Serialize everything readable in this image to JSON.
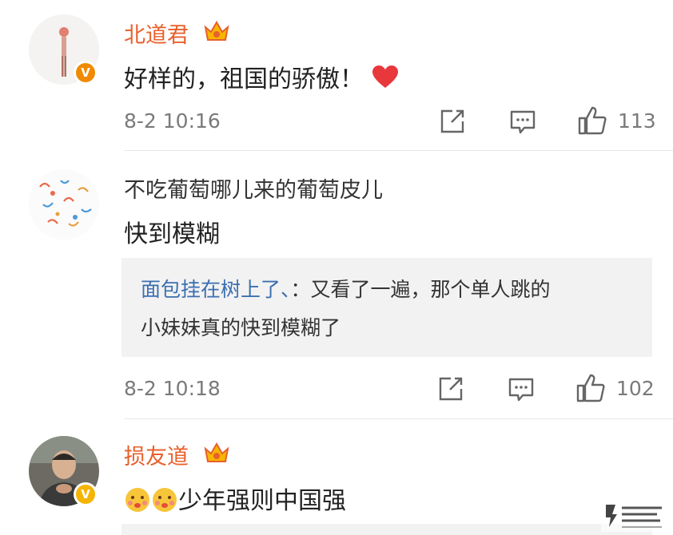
{
  "comments": [
    {
      "username": "北道君",
      "badge": "V",
      "text": "好样的，祖国的骄傲！",
      "time": "8-2 10:16",
      "likes": "113"
    },
    {
      "username": "不吃葡萄哪儿来的葡萄皮儿",
      "text": "快到模糊",
      "reply": {
        "user": "面包挂在树上了、",
        "sep": "：",
        "text_line1": "又看了一遍，那个单人跳的",
        "text_line2": "小妹妹真的快到模糊了"
      },
      "time": "8-2 10:18",
      "likes": "102"
    },
    {
      "username": "损友道",
      "badge": "V",
      "text": "少年强则中国强"
    }
  ],
  "colors": {
    "vip_name": "#e8602c",
    "reply_user": "#3c6fb0",
    "badge_orange": "#f08a00",
    "badge_gold": "#f5b400",
    "meta_gray": "#7a7a7a"
  },
  "icons": {
    "share": "share-icon",
    "comment": "comment-icon",
    "like": "thumbs-up-icon",
    "crown": "crown-icon",
    "heart": "heart-icon",
    "emoji": "kiss-emoji-icon"
  }
}
